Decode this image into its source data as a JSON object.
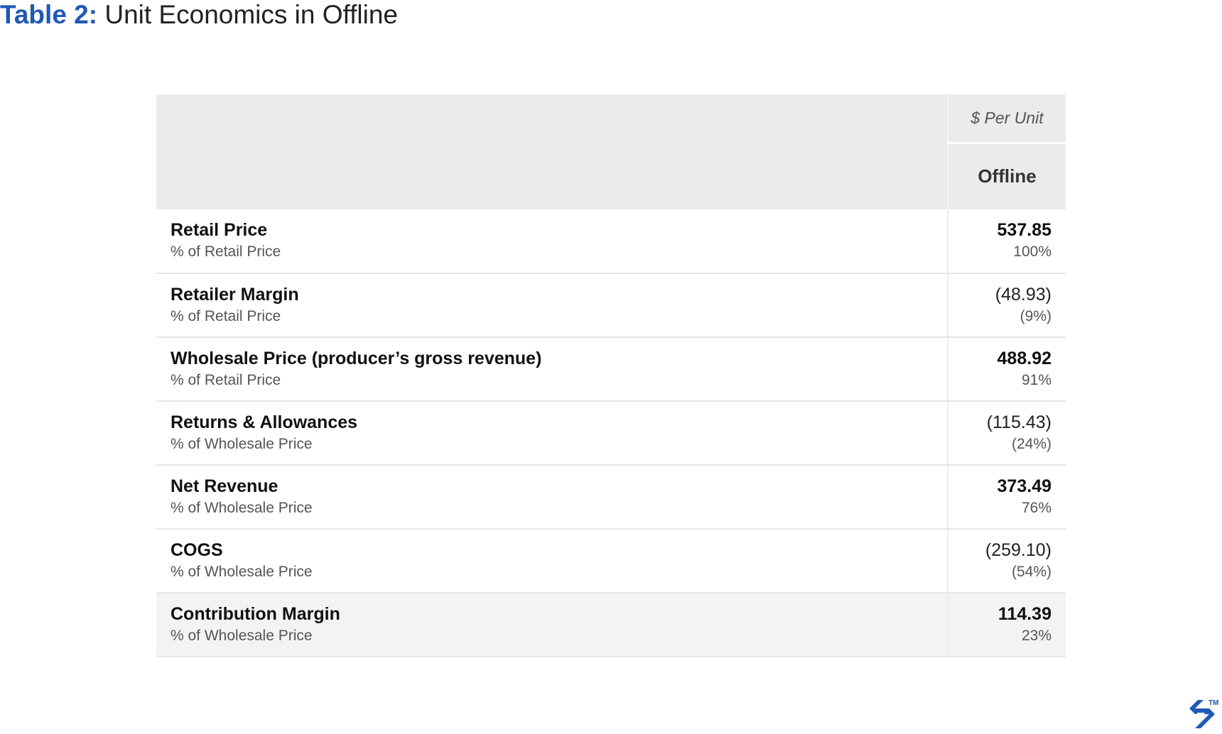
{
  "title": {
    "label": "Table 2:",
    "text": "Unit Economics in Offline"
  },
  "table": {
    "unit_header": "$ Per Unit",
    "column_header": "Offline",
    "rows": [
      {
        "name": "Retail Price",
        "sub": "% of Retail Price",
        "amount": "537.85",
        "pct": "100%",
        "bold": true
      },
      {
        "name": "Retailer Margin",
        "sub": "% of Retail Price",
        "amount": "(48.93)",
        "pct": "(9%)",
        "bold": false
      },
      {
        "name": "Wholesale Price (producer’s gross revenue)",
        "sub": "% of Retail Price",
        "amount": "488.92",
        "pct": "91%",
        "bold": true
      },
      {
        "name": "Returns & Allowances",
        "sub": "% of Wholesale Price",
        "amount": "(115.43)",
        "pct": "(24%)",
        "bold": false
      },
      {
        "name": "Net Revenue",
        "sub": "% of Wholesale Price",
        "amount": "373.49",
        "pct": "76%",
        "bold": true
      },
      {
        "name": "COGS",
        "sub": "% of Wholesale Price",
        "amount": "(259.10)",
        "pct": "(54%)",
        "bold": false
      },
      {
        "name": "Contribution Margin",
        "sub": "% of Wholesale Price",
        "amount": "114.39",
        "pct": "23%",
        "bold": true
      }
    ]
  },
  "brand": {
    "trademark": "TM",
    "accent_color": "#2059b6"
  }
}
